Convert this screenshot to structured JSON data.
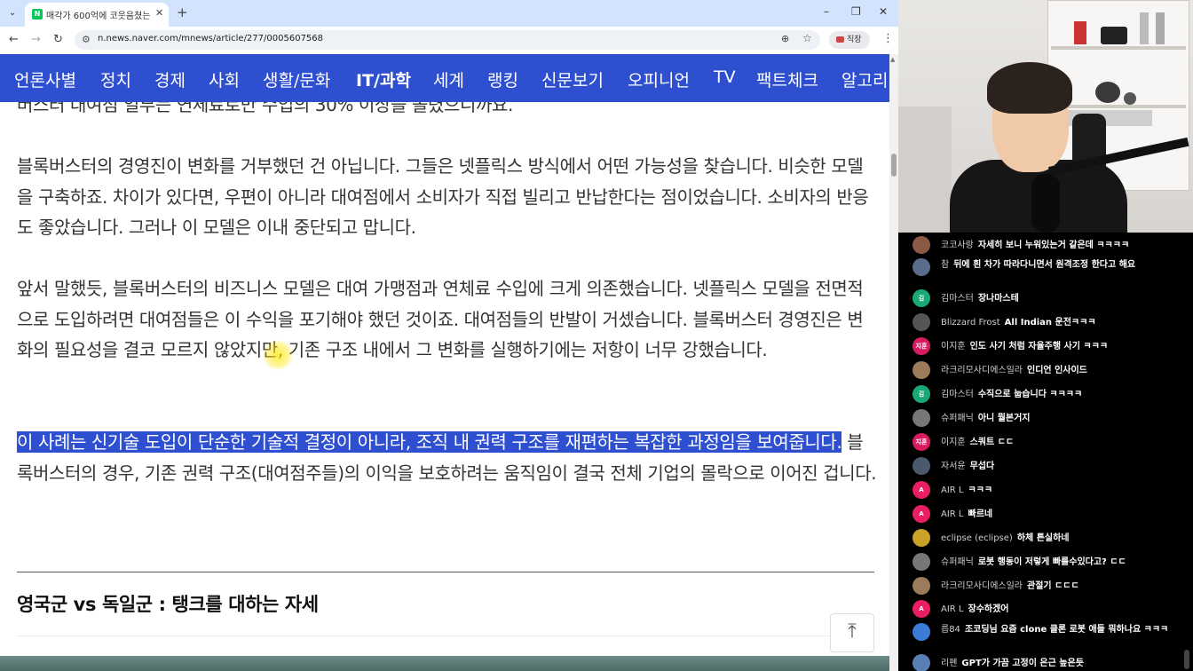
{
  "browser": {
    "tab_title": "매각가 600억에 코웃음쳤는데",
    "tab_favicon": "N",
    "url": "n.news.naver.com/mnews/article/277/0005607568",
    "profile_label": "직장"
  },
  "navbar": {
    "items": [
      "언론사별",
      "정치",
      "경제",
      "사회",
      "생활/문화",
      "IT/과학",
      "세계",
      "랭킹",
      "신문보기",
      "오피니언",
      "TV",
      "팩트체크",
      "알고리"
    ],
    "active": "IT/과학"
  },
  "article": {
    "partial_line": "버스터 대여점 일부는 연체료로만 수입의 30% 이상을 올렸으니까요.",
    "para1": "블록버스터의 경영진이 변화를 거부했던 건 아닙니다. 그들은 넷플릭스 방식에서 어떤 가능성을 찾습니다. 비슷한 모델을 구축하죠. 차이가 있다면, 우편이 아니라 대여점에서 소비자가 직접 빌리고 반납한다는 점이었습니다. 소비자의 반응도 좋았습니다. 그러나 이 모델은 이내 중단되고 맙니다.",
    "para2": "앞서 말했듯, 블록버스터의 비즈니스 모델은 대여 가맹점과 연체료 수입에 크게 의존했습니다. 넷플릭스 모델을 전면적으로 도입하려면 대여점들은 이 수익을 포기해야 했던 것이죠. 대여점들의 반발이 거셌습니다. 블록버스터 경영진은 변화의 필요성을 결코 모르지 않았지만, 기존 구조 내에서 그 변화를 실행하기에는 저항이 너무 강했습니다.",
    "para3_highlight": "이 사례는 신기술 도입이 단순한 기술적 결정이 아니라, 조직 내 권력 구조를 재편하는 복잡한 과정임을 보여줍니다.",
    "para3_rest": " 블록버스터의 경우, 기존 권력 구조(대여점주들)의 이익을 보호하려는 움직임이 결국 전체 기업의 몰락으로 이어진 겁니다.",
    "section_heading": "영국군 vs 독일군 : 탱크를 대하는 자세"
  },
  "chat": {
    "messages": [
      {
        "user": "코코사랑",
        "text": "자세히 보니 누워있는거 같은데 ㅋㅋㅋㅋ",
        "avatar": "",
        "avatar_color": "#8a5a44"
      },
      {
        "user": "참",
        "text": "뒤에 흰 차가 따라다니면서 원격조정 한다고 해요",
        "avatar": "",
        "avatar_color": "#5b6b8c"
      },
      {
        "user": "김마스터",
        "text": "장나마스테",
        "avatar": "김",
        "avatar_color": "#19a974"
      },
      {
        "user": "Blizzard Frost",
        "text": "All Indian 운전ㅋㅋㅋ",
        "avatar": "",
        "avatar_color": "#555555"
      },
      {
        "user": "이지훈",
        "text": "인도 사기 처럼 자율주행 사기 ㅋㅋㅋ",
        "avatar": "지훈",
        "avatar_color": "#d81b60"
      },
      {
        "user": "라크리모사디에스일라",
        "text": "인디언 인사이드",
        "avatar": "",
        "avatar_color": "#9c7b5a"
      },
      {
        "user": "김마스터",
        "text": "수직으로 눕습니다 ㅋㅋㅋㅋ",
        "avatar": "김",
        "avatar_color": "#19a974"
      },
      {
        "user": "슈퍼패닉",
        "text": "아니 뭘본거지",
        "avatar": "",
        "avatar_color": "#777777"
      },
      {
        "user": "이지훈",
        "text": "스쿼트 ㄷㄷ",
        "avatar": "지훈",
        "avatar_color": "#d81b60"
      },
      {
        "user": "자서윤",
        "text": "무섭다",
        "avatar": "",
        "avatar_color": "#4a5a6a"
      },
      {
        "user": "AIR L",
        "text": "ㅋㅋㅋ",
        "avatar": "A",
        "avatar_color": "#e91e63"
      },
      {
        "user": "AIR L",
        "text": "빠르네",
        "avatar": "A",
        "avatar_color": "#e91e63"
      },
      {
        "user": "eclipse (eclipse)",
        "text": "하체 튼실하네",
        "avatar": "",
        "avatar_color": "#c9a227"
      },
      {
        "user": "슈퍼패닉",
        "text": "로봇 행동이 저렇게 빠를수있다고? ㄷㄷ",
        "avatar": "",
        "avatar_color": "#777777"
      },
      {
        "user": "라크리모사디에스일라",
        "text": "관절기 ㄷㄷㄷ",
        "avatar": "",
        "avatar_color": "#9c7b5a"
      },
      {
        "user": "AIR L",
        "text": "장수하겠어",
        "avatar": "A",
        "avatar_color": "#e91e63"
      },
      {
        "user": "릅84",
        "text": "조코딩님 요즘 clone 클론 로봇 애들 뭐하나요 ㅋㅋㅋ",
        "avatar": "",
        "avatar_color": "#3d7bd9"
      },
      {
        "user": "리펜",
        "text": "GPT가 가끔 고정이 은근 높은듯",
        "avatar": "",
        "avatar_color": "#5a7fb5"
      }
    ]
  }
}
